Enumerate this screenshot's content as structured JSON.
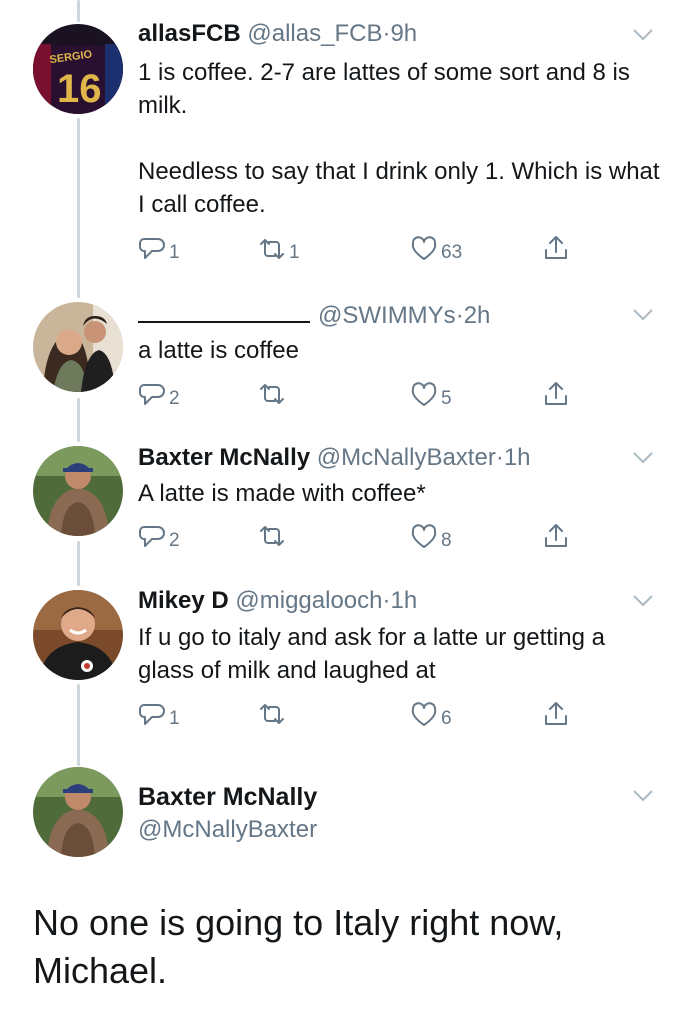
{
  "tweets": [
    {
      "name": "allasFCB",
      "handle": "@allas_FCB",
      "sep": "·",
      "time": "9h",
      "paragraphs": [
        "1 is coffee. 2-7 are lattes of some sort and 8 is milk.",
        "Needless to say that I drink only 1. Which is what I call coffee."
      ],
      "replies": "1",
      "retweets": "1",
      "likes": "63",
      "avatar_icon": "jersey-16-avatar"
    },
    {
      "name": "",
      "handle": "@SWIMMYs",
      "sep": "·",
      "time": "2h",
      "paragraphs": [
        "a latte is coffee"
      ],
      "replies": "2",
      "retweets": "",
      "likes": "5",
      "avatar_icon": "couple-selfie-avatar"
    },
    {
      "name": "Baxter McNally",
      "handle": "@McNallyBaxter",
      "sep": "·",
      "time": "1h",
      "paragraphs": [
        "A latte is made with coffee*"
      ],
      "replies": "2",
      "retweets": "",
      "likes": "8",
      "avatar_icon": "man-with-cap-avatar"
    },
    {
      "name": "Mikey D",
      "handle": "@miggalooch",
      "sep": "·",
      "time": "1h",
      "paragraphs": [
        "If u go to italy and ask for a latte ur getting a glass of milk and laughed at"
      ],
      "replies": "1",
      "retweets": "",
      "likes": "6",
      "avatar_icon": "smiling-man-avatar"
    }
  ],
  "focused_tweet": {
    "name": "Baxter McNally",
    "handle": "@McNallyBaxter",
    "text": "No one is going to Italy right now, Michael.",
    "avatar_icon": "man-with-cap-avatar"
  },
  "colors": {
    "text": "#14171a",
    "secondary": "#657786",
    "thread_line": "#ccd6dd",
    "background": "#ffffff"
  }
}
